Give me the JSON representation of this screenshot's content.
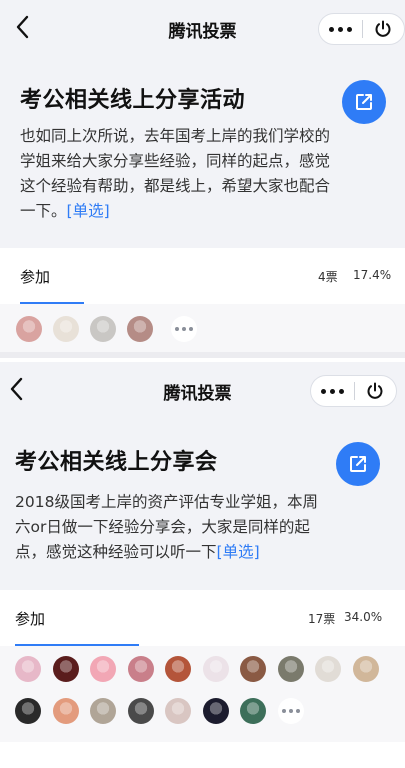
{
  "screens": [
    {
      "nav": {
        "title": "腾讯投票"
      },
      "activity": {
        "title": "考公相关线上分享活动",
        "description": "也如同上次所说，去年国考上岸的我们学校的学姐来给大家分享些经验，同样的起点，感觉这个经验有帮助，都是线上，希望大家也配合一下。",
        "type_tag": "[单选]"
      },
      "option": {
        "label": "参加",
        "votes": "4票",
        "percent": "17.4%",
        "ratio": 0.174
      },
      "avatar_colors": [
        "#d9a3a0",
        "#e8e1d8",
        "#c9c7c4",
        "#b58c86"
      ]
    },
    {
      "nav": {
        "title": "腾讯投票"
      },
      "activity": {
        "title": "考公相关线上分享会",
        "description": "2018级国考上岸的资产评估专业学姐，本周六or日做一下经验分享会，大家是同样的起点，感觉这种经验可以听一下",
        "type_tag": "[单选]"
      },
      "option": {
        "label": "参加",
        "votes": "17票",
        "percent": "34.0%",
        "ratio": 0.34
      },
      "avatar_colors": [
        "#e7b8c8",
        "#5a1d1d",
        "#f2a7b5",
        "#c97f8a",
        "#b4553a",
        "#ece2e8",
        "#8a5a44",
        "#7a7a6c",
        "#e1dcd6",
        "#d1b79a",
        "#2a2a2a",
        "#e39b7d",
        "#b0a597",
        "#4a4a4a",
        "#d9c6c2",
        "#1c1c2e",
        "#3d6f5a"
      ]
    }
  ],
  "colors": {
    "accent": "#2f7cf6"
  },
  "icons": {
    "back": "chevron-left-icon",
    "more": "more-dots-icon",
    "power": "power-icon",
    "share": "share-external-icon"
  }
}
